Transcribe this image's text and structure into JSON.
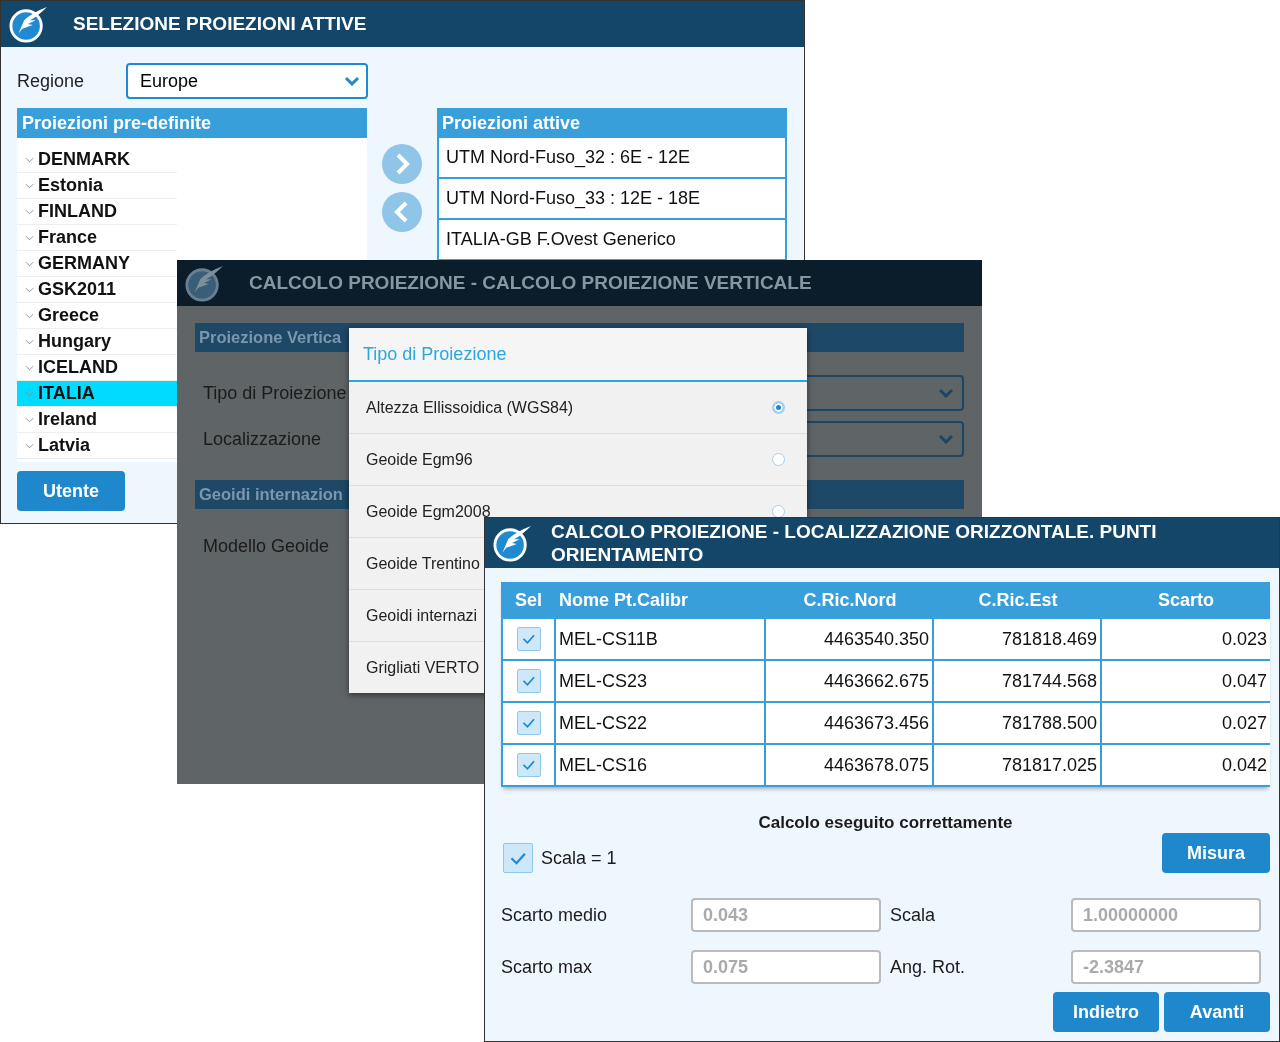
{
  "window_selezione": {
    "title": "SELEZIONE PROIEZIONI ATTIVE",
    "regione": {
      "label": "Regione",
      "value": "Europe"
    },
    "predefinite": {
      "header": "Proiezioni pre-definite",
      "items": [
        {
          "label": "DENMARK",
          "selected": false
        },
        {
          "label": "Estonia",
          "selected": false
        },
        {
          "label": "FINLAND",
          "selected": false
        },
        {
          "label": "France",
          "selected": false
        },
        {
          "label": "GERMANY",
          "selected": false
        },
        {
          "label": "GSK2011",
          "selected": false
        },
        {
          "label": "Greece",
          "selected": false
        },
        {
          "label": "Hungary",
          "selected": false
        },
        {
          "label": "ICELAND",
          "selected": false
        },
        {
          "label": "ITALIA",
          "selected": true
        },
        {
          "label": "Ireland",
          "selected": false
        },
        {
          "label": "Latvia",
          "selected": false
        }
      ]
    },
    "attive": {
      "header": "Proiezioni attive",
      "items": [
        "UTM Nord-Fuso_32 : 6E - 12E",
        "UTM Nord-Fuso_33 : 12E - 18E",
        "ITALIA-GB F.Ovest Generico"
      ]
    },
    "button": "Utente"
  },
  "window_verticale": {
    "title": "CALCOLO PROIEZIONE - CALCOLO PROIEZIONE VERTICALE",
    "section_1": "Proiezione Vertica",
    "fields": [
      "Tipo di Proiezione",
      "Localizzazione"
    ],
    "section_2": "Geoidi internazion",
    "modello": "Modello Geoide",
    "dialog": {
      "title": "Tipo di Proiezione",
      "options": [
        {
          "label": "Altezza Ellissoidica (WGS84)",
          "selected": true
        },
        {
          "label": "Geoide Egm96",
          "selected": false
        },
        {
          "label": "Geoide Egm2008",
          "selected": false
        },
        {
          "label": "Geoide Trentino"
        },
        {
          "label": "Geoidi internazi"
        },
        {
          "label": "Grigliati VERTO"
        }
      ]
    }
  },
  "window_orizzontale": {
    "title": "CALCOLO PROIEZIONE - LOCALIZZAZIONE ORIZZONTALE. PUNTI ORIENTAMENTO",
    "table": {
      "select_column": "Sel",
      "columns": [
        "Nome Pt.Calibr",
        "C.Ric.Nord",
        "C.Ric.Est",
        "Scarto"
      ],
      "rows": [
        {
          "checked": true,
          "cells": [
            "MEL-CS11B",
            "4463540.350",
            "781818.469",
            "0.023"
          ]
        },
        {
          "checked": true,
          "cells": [
            "MEL-CS23",
            "4463662.675",
            "781744.568",
            "0.047"
          ]
        },
        {
          "checked": true,
          "cells": [
            "MEL-CS22",
            "4463673.456",
            "781788.500",
            "0.027"
          ]
        },
        {
          "checked": true,
          "cells": [
            "MEL-CS16",
            "4463678.075",
            "781817.025",
            "0.042"
          ]
        }
      ]
    },
    "status": "Calcolo eseguito correttamente",
    "scala_check": {
      "label": "Scala = 1",
      "checked": true
    },
    "misura": "Misura",
    "results": [
      {
        "label": "Scarto medio",
        "value": "0.043"
      },
      {
        "label": "Scala",
        "value": "1.00000000"
      },
      {
        "label": "Scarto max",
        "value": "0.075"
      },
      {
        "label": "Ang. Rot.",
        "value": "-2.3847"
      }
    ],
    "buttons": [
      "Indietro",
      "Avanti"
    ]
  }
}
